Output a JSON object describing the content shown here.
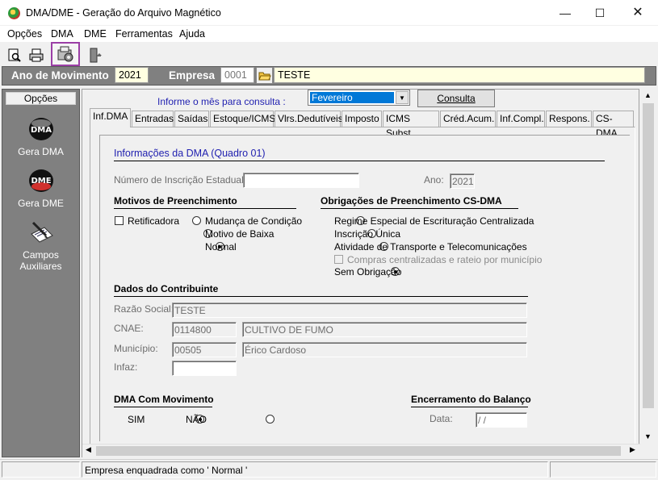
{
  "window": {
    "title": "DMA/DME - Geração do Arquivo Magnético"
  },
  "menu": [
    "Opções",
    "DMA",
    "DME",
    "Ferramentas",
    "Ajuda"
  ],
  "header": {
    "ano_label": "Ano de Movimento",
    "ano_value": "2021",
    "empresa_label": "Empresa",
    "empresa_code": "0001",
    "empresa_name": "TESTE"
  },
  "sidebar": {
    "title": "Opções",
    "items": [
      {
        "label": "Gera DMA",
        "icon": "dma-icon",
        "icon_text": "DMA"
      },
      {
        "label": "Gera DME",
        "icon": "dme-icon",
        "icon_text": "DME"
      },
      {
        "label": "Campos Auxiliares",
        "icon": "notepad-icon"
      }
    ]
  },
  "consulta": {
    "label": "Informe o mês para consulta :",
    "month": "Fevereiro",
    "button": "Consulta"
  },
  "tabs": [
    "Inf.DMA",
    "Entradas",
    "Saídas",
    "Estoque/ICMS",
    "Vlrs.Dedutíveis",
    "Imposto",
    "ICMS Subst.",
    "Créd.Acum.",
    "Inf.Compl.",
    "Respons.",
    "CS-DMA"
  ],
  "form": {
    "heading": "Informações da DMA (Quadro 01)",
    "inscricao_label": "Número de Inscrição Estadual:",
    "inscricao_value": "",
    "ano_label": "Ano:",
    "ano_value": "2021",
    "motivos": {
      "title": "Motivos de Preenchimento",
      "retificadora": "Retificadora",
      "options": [
        "Mudança de Condição",
        "Motivo de Baixa",
        "Normal"
      ],
      "selected": "Normal"
    },
    "obrigacoes": {
      "title": "Obrigações de Preenchimento CS-DMA",
      "options": [
        "Regime Especial de Escrituração Centralizada",
        "Inscrição Única",
        "Atividade de Transporte e Telecomunicações"
      ],
      "compras": "Compras centralizadas e rateio por município",
      "sem": "Sem Obrigação",
      "selected": "Sem Obrigação"
    },
    "contribuinte": {
      "title": "Dados do Contribuinte",
      "razao_label": "Razão Social:",
      "razao_value": "TESTE",
      "cnae_label": "CNAE:",
      "cnae_code": "0114800",
      "cnae_desc": "CULTIVO DE FUMO",
      "municipio_label": "Município:",
      "municipio_code": "00505",
      "municipio_name": "Érico Cardoso",
      "infaz_label": "Infaz:",
      "infaz_value": ""
    },
    "movimento": {
      "title": "DMA Com Movimento",
      "sim": "SIM",
      "nao": "NÃO",
      "selected": "SIM"
    },
    "balanco": {
      "title": "Encerramento do Balanço",
      "data_label": "Data:",
      "data_value": " / /"
    }
  },
  "status": {
    "text": "Empresa enquadrada como ' Normal '"
  },
  "colors": {
    "accent_blue": "#1f1fb0",
    "header_gray": "#808080",
    "highlight_purple": "#9b3fa6",
    "field_yellow": "#ffffe1"
  }
}
